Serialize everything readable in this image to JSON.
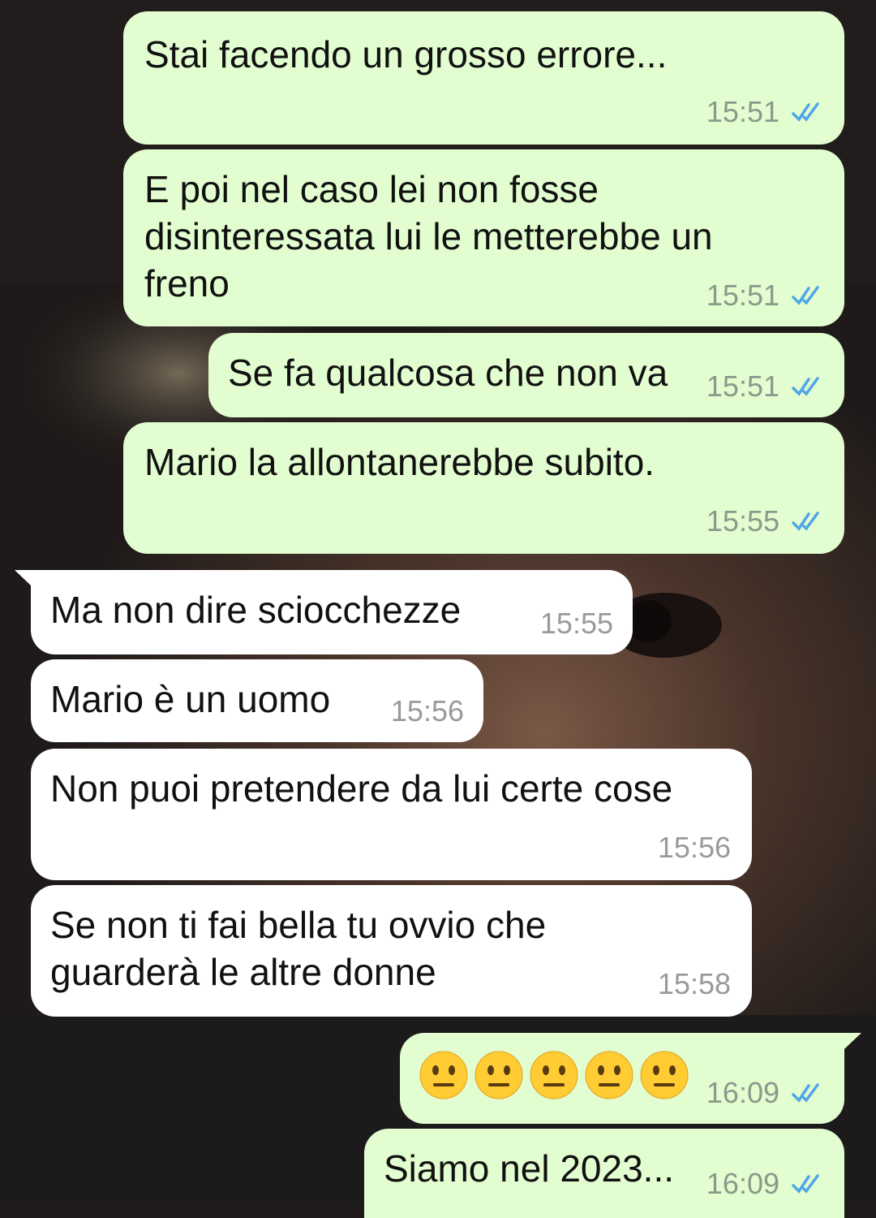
{
  "chat": {
    "messages": [
      {
        "direction": "out",
        "text": "Stai facendo un grosso errore...",
        "time": "15:51",
        "status": "read"
      },
      {
        "direction": "out",
        "text": "E poi nel caso lei non fosse\ndisinteressata lui le metterebbe un\nfreno",
        "time": "15:51",
        "status": "read"
      },
      {
        "direction": "out",
        "text": "Se fa qualcosa che non va",
        "time": "15:51",
        "status": "read"
      },
      {
        "direction": "out",
        "text": "Mario la allontanerebbe subito.",
        "time": "15:55",
        "status": "read"
      },
      {
        "direction": "in",
        "text": "Ma non dire sciocchezze",
        "time": "15:55"
      },
      {
        "direction": "in",
        "text": "Mario è un uomo",
        "time": "15:56"
      },
      {
        "direction": "in",
        "text": "Non puoi pretendere da lui certe cose",
        "time": "15:56"
      },
      {
        "direction": "in",
        "text": "Se non ti fai bella tu ovvio che\nguarderà le altre donne",
        "time": "15:58"
      },
      {
        "direction": "out",
        "emoji": [
          "neutral-face",
          "neutral-face",
          "neutral-face",
          "neutral-face",
          "neutral-face"
        ],
        "time": "16:09",
        "status": "read"
      },
      {
        "direction": "out",
        "text": "Siamo nel 2023...",
        "time": "16:09",
        "status": "read"
      }
    ]
  },
  "colors": {
    "outgoing_bubble": "#e2fdd0",
    "incoming_bubble": "#ffffff",
    "read_tick": "#4fa6e8",
    "timestamp": "#8a9a8a",
    "emoji": "#ffcc33"
  },
  "icons": {
    "read_receipt": "double-check-icon",
    "emoji": "neutral-face-emoji"
  }
}
